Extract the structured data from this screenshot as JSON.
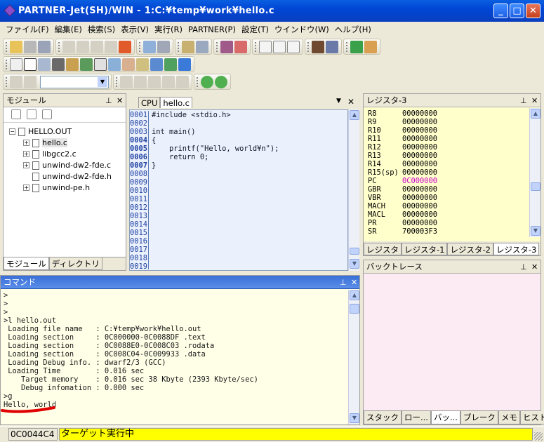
{
  "window": {
    "title": "PARTNER-Jet(SH)/WIN - 1:C:¥temp¥work¥hello.c",
    "minimize": "_",
    "maximize": "□",
    "close": "✕"
  },
  "menu": [
    "ファイル(F)",
    "編集(E)",
    "検索(S)",
    "表示(V)",
    "実行(R)",
    "PARTNER(P)",
    "設定(T)",
    "ウインドウ(W)",
    "ヘルプ(H)"
  ],
  "module_panel": {
    "title": "モジュール",
    "root": "HELLO.OUT",
    "items": [
      "hello.c",
      "libgcc2.c",
      "unwind-dw2-fde.c",
      "unwind-dw2-fde.h",
      "unwind-pe.h"
    ],
    "tabs": [
      "モジュール",
      "ディレクトリ"
    ]
  },
  "source_panel": {
    "tabs": [
      "CPU",
      "hello.c"
    ],
    "lines": [
      {
        "n": "0001",
        "text": "#include <stdio.h>",
        "bold": false
      },
      {
        "n": "0002",
        "text": "",
        "bold": false
      },
      {
        "n": "0003",
        "text": "int main()",
        "bold": false
      },
      {
        "n": "0004",
        "text": "{",
        "bold": true
      },
      {
        "n": "0005",
        "text": "    printf(\"Hello, world¥n\");",
        "bold": true
      },
      {
        "n": "0006",
        "text": "    return 0;",
        "bold": true
      },
      {
        "n": "0007",
        "text": "}",
        "bold": true
      },
      {
        "n": "0008",
        "text": "",
        "bold": false
      },
      {
        "n": "0009",
        "text": "",
        "bold": false
      },
      {
        "n": "0010",
        "text": "",
        "bold": false
      },
      {
        "n": "0011",
        "text": "",
        "bold": false
      },
      {
        "n": "0012",
        "text": "",
        "bold": false
      },
      {
        "n": "0013",
        "text": "",
        "bold": false
      },
      {
        "n": "0014",
        "text": "",
        "bold": false
      },
      {
        "n": "0015",
        "text": "",
        "bold": false
      },
      {
        "n": "0016",
        "text": "",
        "bold": false
      },
      {
        "n": "0017",
        "text": "",
        "bold": false
      },
      {
        "n": "0018",
        "text": "",
        "bold": false
      },
      {
        "n": "0019",
        "text": "",
        "bold": false
      }
    ]
  },
  "register_panel": {
    "title": "レジスタ-3",
    "registers": [
      {
        "name": "R8",
        "value": "00000000",
        "changed": false
      },
      {
        "name": "R9",
        "value": "00000000",
        "changed": false
      },
      {
        "name": "R10",
        "value": "00000000",
        "changed": false
      },
      {
        "name": "R11",
        "value": "00000000",
        "changed": false
      },
      {
        "name": "R12",
        "value": "00000000",
        "changed": false
      },
      {
        "name": "R13",
        "value": "00000000",
        "changed": false
      },
      {
        "name": "R14",
        "value": "00000000",
        "changed": false
      },
      {
        "name": "R15(sp)",
        "value": "00000000",
        "changed": false
      },
      {
        "name": "PC",
        "value": "0C000000",
        "changed": true
      },
      {
        "name": "GBR",
        "value": "00000000",
        "changed": false
      },
      {
        "name": "VBR",
        "value": "00000000",
        "changed": false
      },
      {
        "name": "MACH",
        "value": "00000000",
        "changed": false
      },
      {
        "name": "MACL",
        "value": "00000000",
        "changed": false
      },
      {
        "name": "PR",
        "value": "00000000",
        "changed": false
      },
      {
        "name": "SR",
        "value": "700003F3",
        "changed": false
      }
    ],
    "tabs": [
      "レジスタ",
      "レジスタ-1",
      "レジスタ-2",
      "レジスタ-3"
    ]
  },
  "backtrace_panel": {
    "title": "バックトレース",
    "tabs": [
      "スタック",
      "ロー...",
      "バッ...",
      "ブレーク",
      "メモ",
      "ヒストリ"
    ]
  },
  "command_panel": {
    "title": "コマンド",
    "lines": [
      ">",
      ">",
      ">",
      ">l hello.out",
      " Loading file name   : C:¥temp¥work¥hello.out",
      " Loading section     : 0C000000-0C0088DF .text",
      " Loading section     : 0C0088E0-0C008C03 .rodata",
      " Loading section     : 0C008C04-0C009933 .data",
      " Loading Debug info. : dwarf2/3 (GCC)",
      " Loading Time        : 0.016 sec",
      "    Target memory    : 0.016 sec 38 Kbyte (2393 Kbyte/sec)",
      "    Debug infomation : 0.000 sec",
      ">g",
      "Hello, world"
    ]
  },
  "statusbar": {
    "address": "0C0044C4",
    "message": "ターゲット実行中"
  },
  "colors": {
    "source_bg": "#eaf1fd",
    "register_bg": "#ffffcc",
    "backtrace_bg": "#fcebf2",
    "command_bg": "#ffffe8",
    "status_yellow": "#ffff00",
    "highlight_red": "#e00000"
  }
}
